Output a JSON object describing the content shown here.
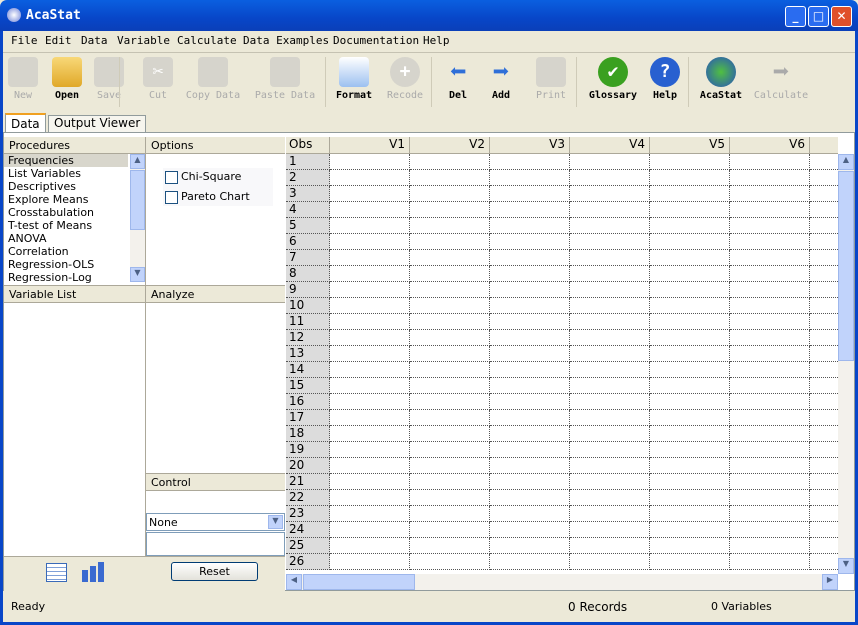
{
  "window": {
    "title": "AcaStat",
    "minimize": "_",
    "maximize": "□",
    "close": "✕"
  },
  "menu": [
    "File",
    "Edit",
    "Data",
    "Variable",
    "Calculate",
    "Data Examples",
    "Documentation",
    "Help"
  ],
  "toolbar": [
    {
      "label": "New",
      "icon": "new-table-icon",
      "enabled": false
    },
    {
      "label": "Open",
      "icon": "folder-open-icon",
      "enabled": true
    },
    {
      "label": "Save",
      "icon": "floppy-disk-icon",
      "enabled": false
    },
    {
      "label": "Cut",
      "icon": "scissors-icon",
      "enabled": false
    },
    {
      "label": "Copy Data",
      "icon": "copy-icon",
      "enabled": false
    },
    {
      "label": "Paste Data",
      "icon": "paste-icon",
      "enabled": false
    },
    {
      "label": "Format",
      "icon": "format-window-icon",
      "enabled": true
    },
    {
      "label": "Recode",
      "icon": "plus-circle-icon",
      "enabled": false
    },
    {
      "label": "Del",
      "icon": "arrow-left-icon",
      "enabled": true
    },
    {
      "label": "Add",
      "icon": "arrow-right-icon",
      "enabled": true
    },
    {
      "label": "Print",
      "icon": "printer-icon",
      "enabled": false
    },
    {
      "label": "Glossary",
      "icon": "checkmark-icon",
      "enabled": true
    },
    {
      "label": "Help",
      "icon": "question-icon",
      "enabled": true
    },
    {
      "label": "AcaStat",
      "icon": "globe-icon",
      "enabled": true
    },
    {
      "label": "Calculate",
      "icon": "arrow-calc-icon",
      "enabled": false
    }
  ],
  "tabs": [
    {
      "label": "Data",
      "active": true
    },
    {
      "label": "Output Viewer",
      "active": false
    }
  ],
  "procedures": {
    "header": "Procedures",
    "selected": "Frequencies",
    "items": [
      "Frequencies",
      "List Variables",
      "Descriptives",
      "Explore Means",
      "Crosstabulation",
      "T-test of Means",
      "ANOVA",
      "Correlation",
      "Regression-OLS",
      "Regression-Log"
    ]
  },
  "options": {
    "header": "Options",
    "checkboxes": [
      {
        "label": "Chi-Square",
        "checked": false
      },
      {
        "label": "Pareto Chart",
        "checked": false
      }
    ]
  },
  "variable_list": {
    "header": "Variable List"
  },
  "analyze": {
    "header": "Analyze"
  },
  "control": {
    "header": "Control",
    "select_value": "None"
  },
  "reset_label": "Reset",
  "grid": {
    "obs_header": "Obs",
    "columns": [
      "V1",
      "V2",
      "V3",
      "V4",
      "V5",
      "V6"
    ],
    "rows": [
      1,
      2,
      3,
      4,
      5,
      6,
      7,
      8,
      9,
      10,
      11,
      12,
      13,
      14,
      15,
      16,
      17,
      18,
      19,
      20,
      21,
      22,
      23,
      24,
      25,
      26
    ]
  },
  "status": {
    "text": "Ready",
    "records": "0 Records",
    "variables": "0 Variables"
  }
}
